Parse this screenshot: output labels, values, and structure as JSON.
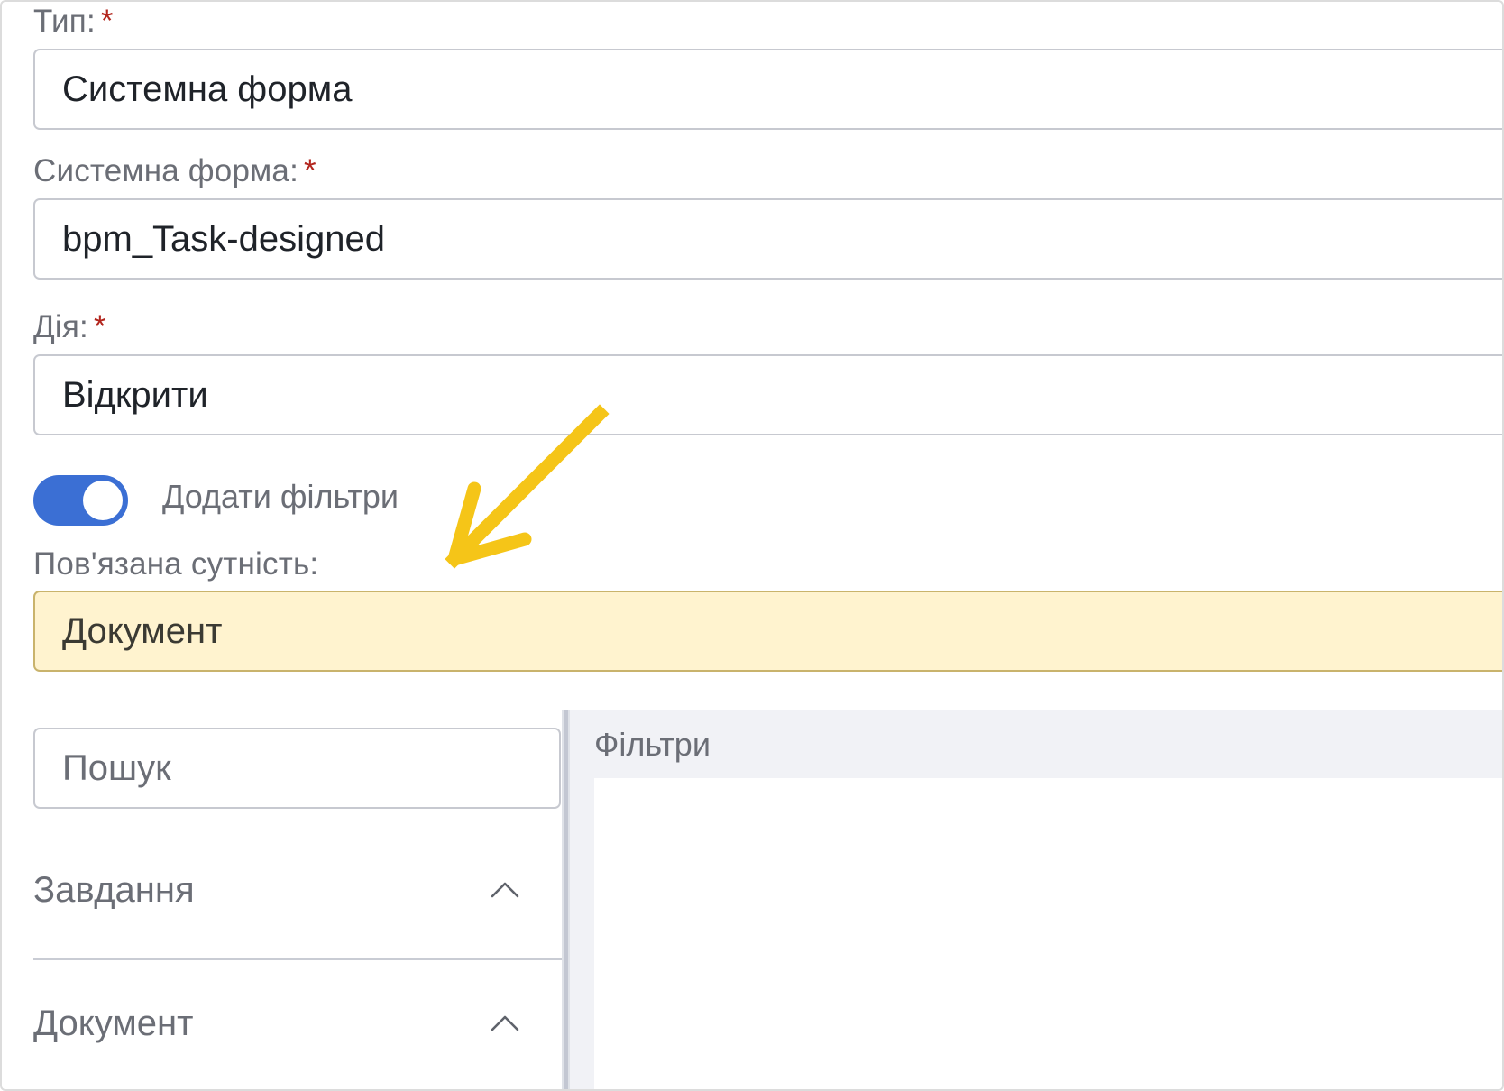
{
  "form": {
    "type": {
      "label": "Тип:",
      "required_mark": "*",
      "value": "Системна форма"
    },
    "system_form": {
      "label": "Системна форма:",
      "required_mark": "*",
      "value": "bpm_Task-designed"
    },
    "action": {
      "label": "Дія:",
      "required_mark": "*",
      "value": "Відкрити"
    },
    "add_filters": {
      "label": "Додати фільтри",
      "enabled": true
    },
    "related_entity": {
      "label": "Пов'язана сутність:",
      "value": "Документ"
    }
  },
  "filter_builder": {
    "search": {
      "placeholder": "Пошук"
    },
    "sections": [
      {
        "title": "Завдання",
        "expanded": true,
        "icon": "chevron-up-icon"
      },
      {
        "title": "Документ",
        "expanded": true,
        "icon": "chevron-up-icon"
      }
    ],
    "filters_panel": {
      "title": "Фільтри"
    }
  },
  "annotation": {
    "icon": "arrow-pointer-icon",
    "color": "#f5c518"
  },
  "colors": {
    "toggle_on": "#3b6fd4",
    "highlight_fill": "#fff3cf",
    "required": "#b3261e"
  }
}
